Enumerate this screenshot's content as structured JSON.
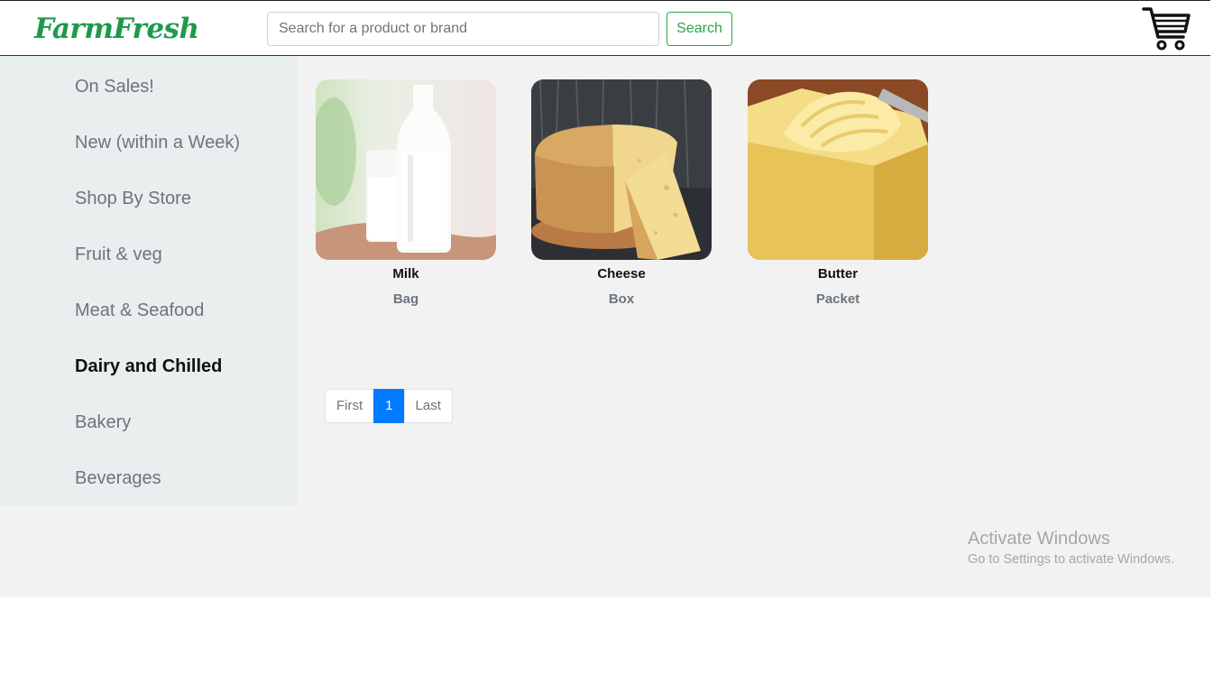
{
  "header": {
    "logo_text": "FarmFresh",
    "search_placeholder": "Search for a product or brand",
    "search_label": "Search",
    "cart_icon": "shopping-cart-icon"
  },
  "sidebar": {
    "items": [
      {
        "label": "On Sales!",
        "active": false
      },
      {
        "label": "New (within a Week)",
        "active": false
      },
      {
        "label": "Shop By Store",
        "active": false
      },
      {
        "label": "Fruit & veg",
        "active": false
      },
      {
        "label": "Meat & Seafood",
        "active": false
      },
      {
        "label": "Dairy and Chilled",
        "active": true
      },
      {
        "label": "Bakery",
        "active": false
      },
      {
        "label": "Beverages",
        "active": false
      }
    ]
  },
  "products": [
    {
      "name": "Milk",
      "unit": "Bag",
      "image": "milk-bottle-photo"
    },
    {
      "name": "Cheese",
      "unit": "Box",
      "image": "cheese-wheel-photo"
    },
    {
      "name": "Butter",
      "unit": "Packet",
      "image": "butter-block-photo"
    }
  ],
  "pagination": {
    "first_label": "First",
    "current_page": "1",
    "last_label": "Last"
  },
  "watermark": {
    "title": "Activate Windows",
    "subtitle": "Go to Settings to activate Windows."
  },
  "colors": {
    "brand_green": "#1e9a4a",
    "search_button_green": "#28a745",
    "active_page_blue": "#007bff",
    "sidebar_bg": "#e9eeee",
    "main_bg": "#f2f2f2"
  }
}
